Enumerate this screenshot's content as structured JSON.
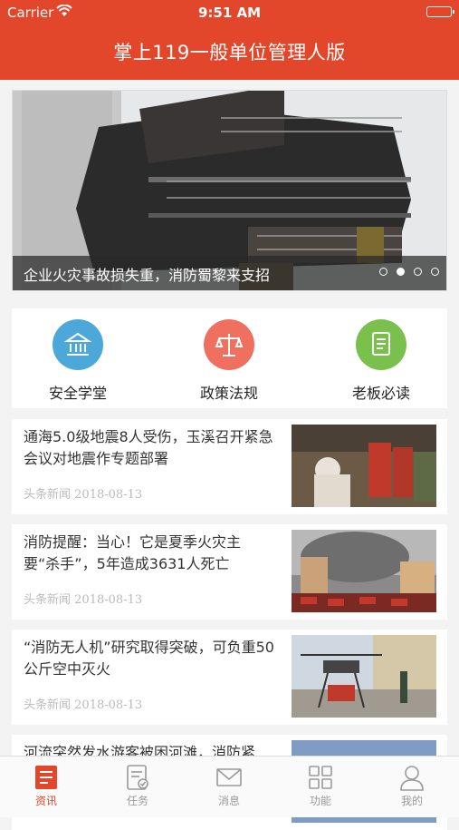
{
  "status_bar": {
    "carrier": "Carrier",
    "time": "9:51 AM"
  },
  "header": {
    "title": "掌上119一般单位管理人版"
  },
  "banner": {
    "caption": "企业火灾事故损失重，消防蜀黎来支招",
    "slide_count": 4,
    "active_slide": 2
  },
  "categories": [
    {
      "label": "安全学堂",
      "icon": "bank-icon",
      "color": "#4ba8d8"
    },
    {
      "label": "政策法规",
      "icon": "scales-icon",
      "color": "#f07060"
    },
    {
      "label": "老板必读",
      "icon": "book-icon",
      "color": "#7ac04c"
    }
  ],
  "news": [
    {
      "title": "通海5.0级地震8人受伤，玉溪召开紧急会议对地震作专题部署",
      "source": "头条新闻",
      "date": "2018-08-13"
    },
    {
      "title": "消防提醒：当心！它是夏季火灾主要“杀手”，5年造成3631人死亡",
      "source": "头条新闻",
      "date": "2018-08-13"
    },
    {
      "title": "“消防无人机”研究取得突破，可负重50公斤空中灭火",
      "source": "头条新闻",
      "date": "2018-08-13"
    },
    {
      "title": "河流突然发水游客被困河滩，消防紧",
      "source": "",
      "date": ""
    }
  ],
  "tabbar": [
    {
      "label": "资讯",
      "icon": "news-icon",
      "active": true
    },
    {
      "label": "任务",
      "icon": "task-icon",
      "active": false
    },
    {
      "label": "消息",
      "icon": "mail-icon",
      "active": false
    },
    {
      "label": "功能",
      "icon": "grid-icon",
      "active": false
    },
    {
      "label": "我的",
      "icon": "user-icon",
      "active": false
    }
  ],
  "colors": {
    "brand": "#e2472b",
    "inactive_tab": "#999999"
  }
}
